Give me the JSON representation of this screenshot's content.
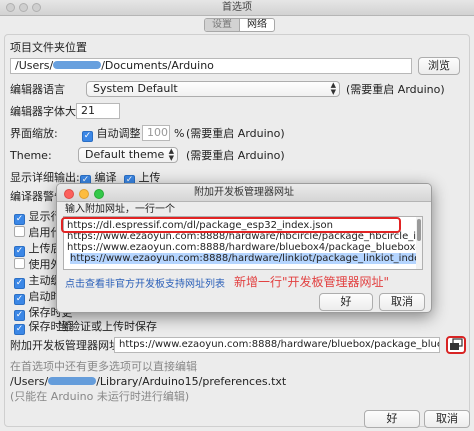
{
  "window": {
    "title": "首选项"
  },
  "tabs": [
    {
      "label": "设置"
    },
    {
      "label": "网络"
    }
  ],
  "settings": {
    "sketchbook_label": "项目文件夹位置",
    "sketchbook_path_prefix": "/Users/",
    "sketchbook_path_suffix": "/Documents/Arduino",
    "browse_label": "浏览",
    "language_label": "编辑器语言",
    "language_value": "System Default",
    "language_note": "(需要重启 Arduino)",
    "fontsize_label": "编辑器字体大小",
    "fontsize_value": "21",
    "scale_label": "界面缩放:",
    "autoscale_label": "自动调整",
    "scale_value": "100",
    "scale_unit": "%",
    "scale_note": "(需要重启 Arduino)",
    "theme_label": "Theme:",
    "theme_value": "Default theme",
    "theme_note": "(需要重启 Arduino)",
    "verbose_label": "显示详细输出:",
    "verbose_compile": "编译",
    "verbose_upload": "上传",
    "warnings_label": "编译器警告:",
    "checkbox_partial": [
      "显示行号",
      "启用代码",
      "上传后验",
      "使用外部",
      "主动缓存",
      "启动时检",
      "保存时更",
      "保存时验"
    ],
    "save_on_verify": "当验证或上传时保存",
    "boards_url_label": "附加开发板管理器网址:",
    "boards_url_value": "https://www.ezaoyun.com:8888/hardware/bluebox/package_bluebox3_index.json",
    "more_prefs_note": "在首选项中还有更多选项可以直接编辑",
    "prefs_path_prefix": "/Users/",
    "prefs_path_suffix": "/Library/Arduino15/preferences.txt",
    "edit_note": "(只能在 Arduino 未运行时进行编辑)",
    "ok_label": "好",
    "cancel_label": "取消"
  },
  "dialog": {
    "title": "附加开发板管理器网址",
    "prompt": "输入附加网址，一行一个",
    "urls": [
      "https://dl.espressif.com/dl/package_esp32_index.json",
      "https://www.ezaoyun.com:8888/hardware/hbcircle/package_hbcircle_index.json",
      "https://www.ezaoyun.com:8888/hardware/bluebox4/package_bluebox4_index.json"
    ],
    "selected_url": "https://www.ezaoyun.com:8888/hardware/linkiot/package_linkiot_index.json",
    "unofficial_link": "点击查看非官方开发板支持网址列表",
    "ok_label": "好",
    "cancel_label": "取消"
  },
  "annotation": {
    "text": "新增一行\"开发板管理器网址\""
  },
  "colors": {
    "accent": "#3b87e6",
    "annotation": "#e24040",
    "highlight_border": "#e12424"
  }
}
